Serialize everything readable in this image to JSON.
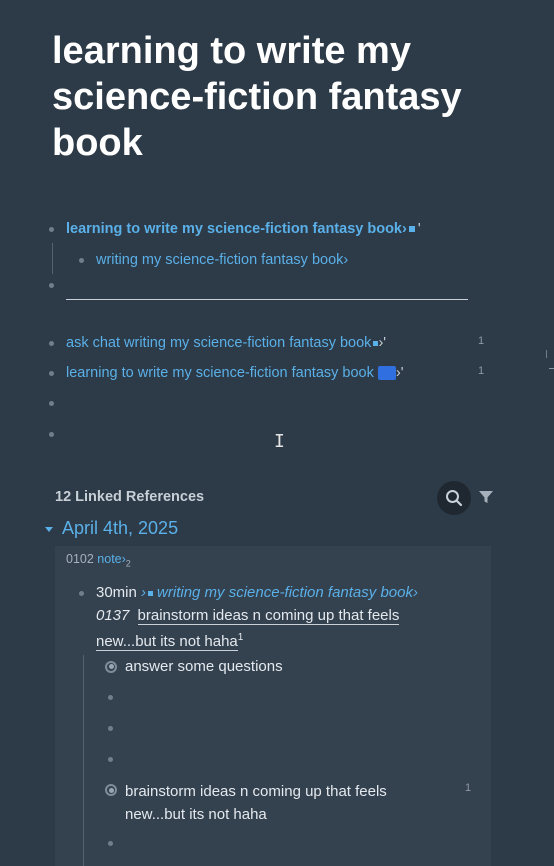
{
  "page": {
    "title": "learning to write my science-fiction fantasy book"
  },
  "blocks": {
    "b1_link": "learning to write my science-fiction fantasy book›",
    "b1_tail": "'",
    "b2_link": "writing my science-fiction fantasy book›",
    "b4_link": "ask chat writing my science-fiction fantasy book",
    "b4_tail": "›'",
    "b4_count": "1",
    "b5_link": "learning to write my science-fiction fantasy book",
    "b5_tail": "›'",
    "b5_count": "1"
  },
  "references": {
    "header": "12 Linked References",
    "date": "April 4th, 2025",
    "crumb_prefix": "0102",
    "crumb_link": "note›",
    "crumb_sub": "2",
    "main": {
      "time": "30min",
      "arrow": "›",
      "link": "writing my science-fiction fantasy book›",
      "code": "0137",
      "text": "brainstorm ideas n coming up that feels new...but its not haha",
      "sup": "1"
    },
    "children": [
      {
        "text": "answer some questions"
      },
      {
        "text": ""
      },
      {
        "text": ""
      },
      {
        "text": ""
      },
      {
        "text": "brainstorm ideas n coming up that feels new...but its not haha",
        "count": "1"
      },
      {
        "text": ""
      }
    ]
  },
  "icons": {
    "search": "search-icon",
    "filter": "filter-icon",
    "collapse": "caret-down-icon"
  },
  "colors": {
    "background": "#2d3a47",
    "link": "#5ab0e8",
    "title": "#ffffff",
    "panel": "#34414f"
  }
}
